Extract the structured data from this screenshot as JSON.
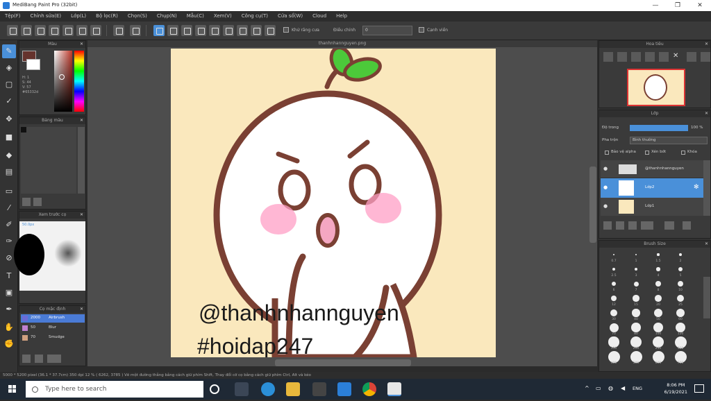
{
  "window": {
    "title": "MediBang Paint Pro (32bit)",
    "min": "—",
    "max": "❐",
    "close": "✕"
  },
  "menu": [
    "Tệp(F)",
    "Chỉnh sửa(E)",
    "Lớp(L)",
    "Bộ lọc(R)",
    "Chọn(S)",
    "Chụp(N)",
    "Mẫu(C)",
    "Xem(V)",
    "Công cụ(T)",
    "Cửa sổ(W)",
    "Cloud",
    "Help"
  ],
  "toolbar": {
    "anti_alias_label": "Khử răng cưa",
    "correction_label": "Điều chỉnh",
    "correction_value": "0",
    "snap_label": "Cạnh viền"
  },
  "color_panel": {
    "title": "Màu",
    "hex": "#65332d",
    "h": "H: 1",
    "s": "S: 44",
    "v": "V: 57",
    "swatch_fg": "#65332d",
    "swatch_bg": "#ffffff"
  },
  "palette_panel": {
    "title": "Bảng màu"
  },
  "brush_preview_panel": {
    "title": "Xem trước cọ",
    "size_label": "50.0px"
  },
  "brush_list_panel": {
    "title": "Cọ mặc định",
    "items": [
      {
        "name": "Airbrush",
        "size": "2000",
        "color": "#6b6bd6"
      },
      {
        "name": "Blur",
        "size": "50",
        "color": "#c080d0"
      },
      {
        "name": "Smudge",
        "size": "70",
        "color": "#d0a080"
      }
    ]
  },
  "document": {
    "tab_title": "thanhnhannguyen.png",
    "watermark_line1": "@thanhnhannguyen",
    "watermark_line2": "#hoidap247"
  },
  "navigator_panel": {
    "title": "Hoa tiêu"
  },
  "layer_panel": {
    "title": "Lớp",
    "opacity_label": "Độ trong",
    "opacity_value": "100 %",
    "blend_label": "Pha trộn",
    "blend_value": "Bình thường",
    "protect_alpha": "Bảo vệ alpha",
    "clipping": "Xén bớt",
    "lock": "Khóa",
    "layers": [
      {
        "name": "@thanhnhannguyen"
      },
      {
        "name": "Lớp2"
      },
      {
        "name": "Lớp1"
      }
    ]
  },
  "brush_size_panel": {
    "title": "Brush Size",
    "sizes": [
      "0.7",
      "1",
      "1.5",
      "2",
      "2.5",
      "3",
      "4",
      "5",
      "6",
      "7",
      "8",
      "10",
      "12",
      "15",
      "20",
      "25",
      "30",
      "40",
      "50",
      "60",
      "70",
      "80",
      "100",
      "120",
      "150",
      "200",
      "250",
      "300",
      "400",
      "500",
      "600",
      "700"
    ]
  },
  "statusbar": {
    "text": "5000 * 5200 pixel  (36.1 * 37.7cm)  350 dpi  12 %  ( 6262, 3785 )  Vẽ một đường thẳng bằng cách giữ phím Shift, Thay đổi cỡ cọ bằng cách giữ phím Ctrl, Alt và kéo"
  },
  "taskbar": {
    "search_placeholder": "Type here to search",
    "lang": "ENG",
    "time": "8:06 PM",
    "date": "6/19/2021"
  }
}
